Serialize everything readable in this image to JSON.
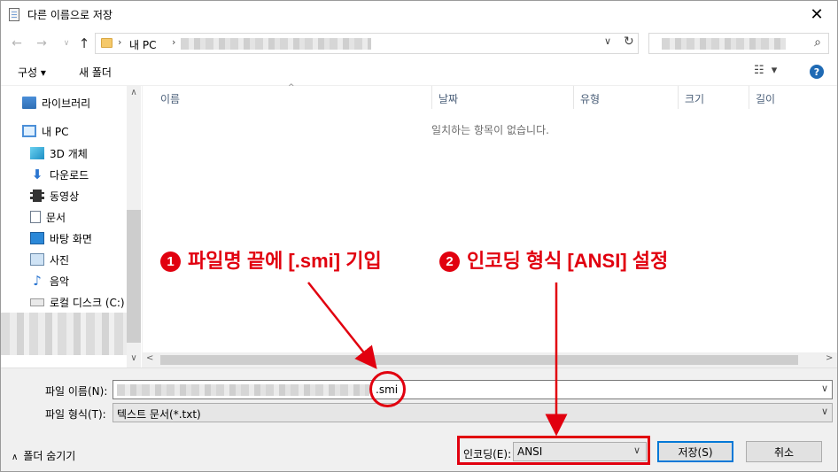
{
  "window": {
    "title": "다른 이름으로 저장",
    "close_glyph": "✕"
  },
  "address": {
    "crumb_sep": "›",
    "crumb_pc": "내 PC",
    "dropdown_glyph": "∨",
    "refresh_glyph": "↻",
    "back_glyph": "←",
    "forward_glyph": "→",
    "recent_glyph": "∨",
    "up_glyph": "↑",
    "search_glyph": "⌕"
  },
  "toolbar": {
    "organize_label": "구성 ▾",
    "new_folder_label": "새 폴더",
    "view_glyph": "☷ ▾",
    "help_glyph": "?"
  },
  "nav": {
    "items": [
      {
        "label": "라이브러리",
        "icon": "library-icon"
      },
      {
        "label": "내 PC",
        "icon": "pc-icon"
      },
      {
        "label": "3D 개체",
        "icon": "3d-objects-icon"
      },
      {
        "label": "다운로드",
        "icon": "download-icon"
      },
      {
        "label": "동영상",
        "icon": "video-icon"
      },
      {
        "label": "문서",
        "icon": "document-icon"
      },
      {
        "label": "바탕 화면",
        "icon": "desktop-icon"
      },
      {
        "label": "사진",
        "icon": "pictures-icon"
      },
      {
        "label": "음악",
        "icon": "music-icon"
      },
      {
        "label": "로컬 디스크 (C:)",
        "icon": "drive-icon"
      }
    ],
    "scroll_up": "∧",
    "scroll_down": "∨"
  },
  "filelist": {
    "columns": [
      "이름",
      "날짜",
      "유형",
      "크기",
      "길이"
    ],
    "sort_glyph": "^",
    "empty_message": "일치하는 항목이 없습니다.",
    "scroll_left": "<",
    "scroll_right": ">"
  },
  "form": {
    "filename_label": "파일 이름(N):",
    "filename_ext": ".smi",
    "filetype_label": "파일 형식(T):",
    "filetype_value": "텍스트 문서(*.txt)",
    "encoding_label": "인코딩(E):",
    "encoding_value": "ANSI",
    "caret_glyph": "∨",
    "hide_folders_chevron": "∧",
    "hide_folders_label": "폴더 숨기기",
    "save_label": "저장(S)",
    "cancel_label": "취소"
  },
  "annotations": {
    "step1_num": "1",
    "step1_text": "파일명 끝에 [.smi] 기입",
    "step2_num": "2",
    "step2_text": "인코딩 형식 [ANSI] 설정",
    "accent_color": "#e1000f"
  }
}
